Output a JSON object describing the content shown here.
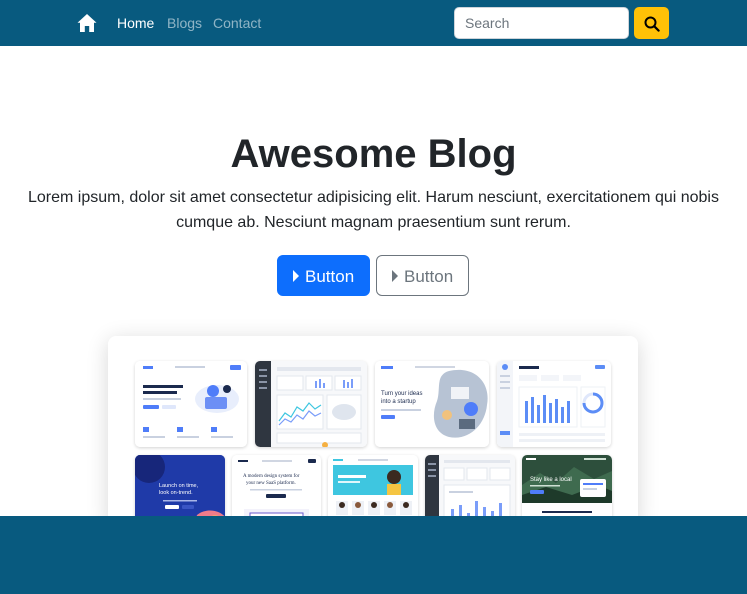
{
  "colors": {
    "navbar_bg": "#085a7f",
    "primary": "#0d6efd",
    "warning": "#ffc107",
    "secondary": "#6c757d",
    "footer_bg": "#085a7f"
  },
  "navbar": {
    "home_icon": "home-icon",
    "links": [
      {
        "label": "Home",
        "active": true
      },
      {
        "label": "Blogs",
        "active": false
      },
      {
        "label": "Contact",
        "active": false
      }
    ],
    "search": {
      "placeholder": "Search",
      "button_icon": "search-icon"
    }
  },
  "hero": {
    "title": "Awesome Blog",
    "text": "Lorem ipsum, dolor sit amet consectetur adipisicing elit. Harum nesciunt, exercitationem qui nobis cumque ab. Nesciunt magnam praesentium sunt rerum.",
    "primary_button": {
      "label": "Button",
      "icon": "caret-right-icon"
    },
    "secondary_button": {
      "label": "Button",
      "icon": "caret-right-icon"
    }
  },
  "preview": {
    "thumbnails": [
      {
        "name": "landing-page-template",
        "heading": "Welcome to Landkit. Develop anything.",
        "accent": "#4f7df9"
      },
      {
        "name": "dark-dashboard-template",
        "heading": "",
        "accent": "#2f3640"
      },
      {
        "name": "startup-template",
        "heading": "Turn your ideas into a startup",
        "accent": "#4f7df9"
      },
      {
        "name": "analytics-dashboard-template",
        "heading": "Dashboard",
        "accent": "#5c8df6"
      },
      {
        "name": "launch-template",
        "heading": "Launch on time, look on-trend.",
        "accent": "#1f3aa8"
      },
      {
        "name": "design-system-template",
        "heading": "A modern design system for your new SaaS platform.",
        "accent": "#6a5acd"
      },
      {
        "name": "fashion-template",
        "heading": "",
        "accent": "#3ec6e0"
      },
      {
        "name": "admin-template",
        "heading": "",
        "accent": "#2f3640"
      },
      {
        "name": "travel-template",
        "heading": "Stay like a local",
        "accent": "#2d4f3c"
      }
    ]
  }
}
